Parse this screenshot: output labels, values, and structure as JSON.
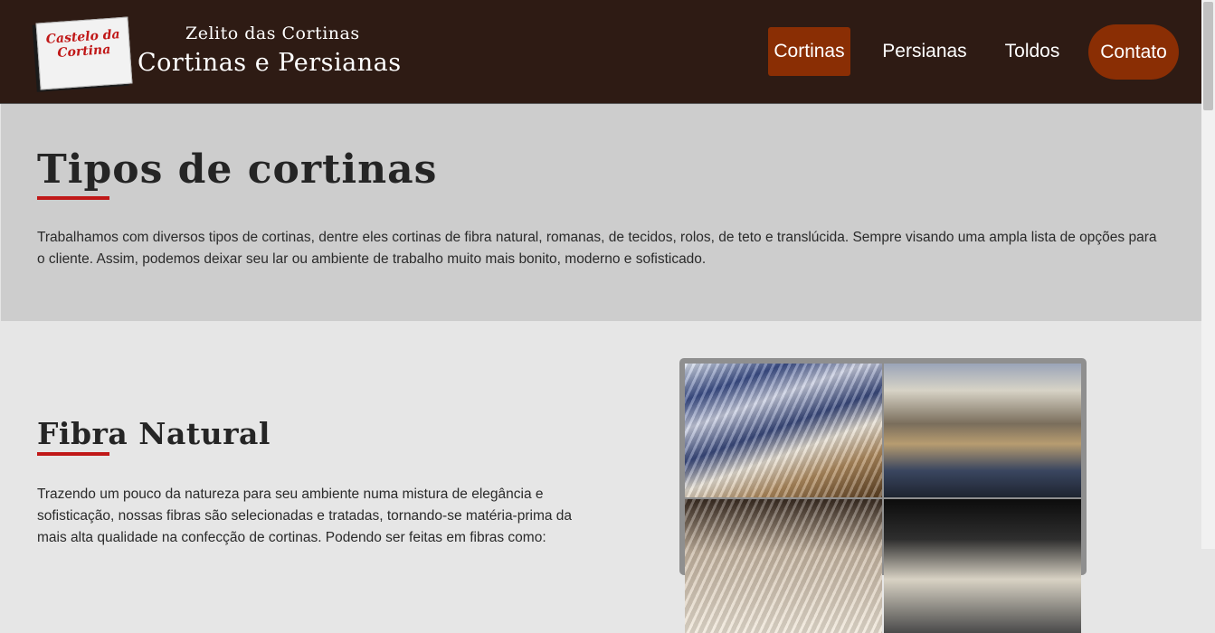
{
  "header": {
    "logo_text": "Castelo da Cortina",
    "brand_top": "Zelito das Cortinas",
    "brand_main": "Cortinas e Persianas"
  },
  "nav": {
    "items": [
      {
        "label": "Cortinas",
        "active": true
      },
      {
        "label": "Persianas"
      },
      {
        "label": "Toldos"
      },
      {
        "label": "Contato"
      }
    ]
  },
  "intro": {
    "title": "Tipos de cortinas",
    "text": "Trabalhamos com diversos tipos de cortinas, dentre eles cortinas de fibra natural, romanas, de tecidos, rolos, de teto e translúcida. Sempre visando uma ampla lista de opções para o cliente. Assim, podemos deixar seu lar ou ambiente de trabalho muito mais bonito, moderno e sofisticado."
  },
  "section": {
    "title": "Fibra Natural",
    "text": "Trazendo um pouco da natureza para seu ambiente numa mistura de elegância e sofisticação, nossas fibras são selecionadas e tratadas, tornando-se matéria-prima da mais alta qualidade na confecção de cortinas. Podendo ser feitas em fibras como:"
  },
  "colors": {
    "header_bg": "#2e1b14",
    "accent": "#8a2e04",
    "underline": "#c01818",
    "intro_bg": "#cdcdcd",
    "section_bg": "#e6e6e6"
  }
}
